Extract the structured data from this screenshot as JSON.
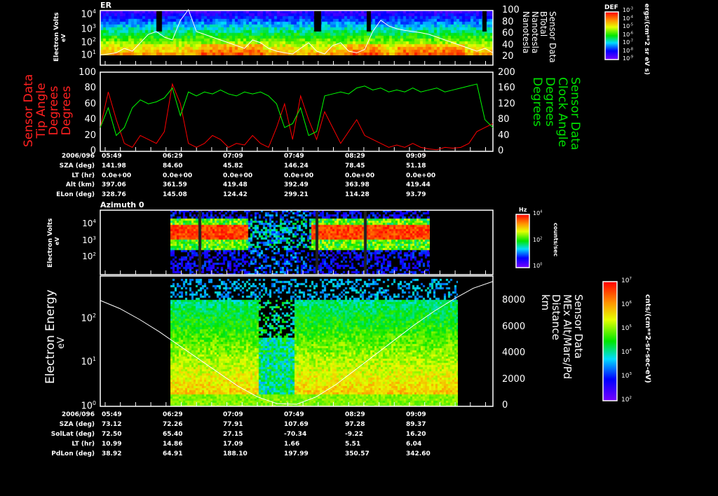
{
  "chart_data": [
    {
      "type": "heatmap",
      "title": "ER",
      "ylabel": "Electron Volts",
      "yunit": "eV",
      "yscale": "log",
      "yticks": [
        "10^1",
        "10^2",
        "10^3",
        "10^4"
      ],
      "right_axis": {
        "label": [
          "Sensor Data",
          "BTotal",
          "Nanotesla",
          "Nanotesla"
        ],
        "ticks": [
          20,
          40,
          60,
          80,
          100
        ]
      },
      "colorbar": {
        "title": "DEF",
        "unit": "ergs/(cm**2 sr eV s)",
        "ticks": [
          "10^-3",
          "10^-4",
          "10^-5",
          "10^-6",
          "10^-7",
          "10^-8",
          "10^-9"
        ]
      },
      "btotal_nT": [
        18,
        20,
        22,
        30,
        25,
        40,
        55,
        60,
        50,
        45,
        80,
        99,
        60,
        55,
        50,
        45,
        40,
        35,
        30,
        45,
        40,
        30,
        25,
        22,
        20,
        30,
        40,
        25,
        20,
        35,
        40,
        25,
        22,
        28,
        60,
        80,
        70,
        65,
        62,
        60,
        58,
        55,
        50,
        45,
        40,
        35,
        30,
        25,
        30,
        22
      ]
    },
    {
      "type": "line",
      "left_label": [
        "Sensor Data",
        "Tip Angle",
        "Degrees",
        "Degrees"
      ],
      "right_label": [
        "Sensor Data",
        "Clock Angle",
        "Degrees",
        "Degrees"
      ],
      "ylim": [
        0,
        100
      ],
      "y2lim": [
        0,
        200
      ],
      "yticks": [
        0,
        20,
        40,
        60,
        80,
        100
      ],
      "y2ticks": [
        0,
        40,
        80,
        120,
        160,
        200
      ],
      "series": [
        {
          "name": "Tip Angle",
          "color": "#ff0000",
          "values": [
            30,
            75,
            40,
            10,
            5,
            20,
            15,
            10,
            25,
            85,
            60,
            10,
            5,
            10,
            20,
            15,
            5,
            10,
            8,
            20,
            10,
            5,
            30,
            60,
            15,
            70,
            40,
            15,
            50,
            30,
            10,
            25,
            40,
            20,
            15,
            10,
            5,
            8,
            5,
            10,
            5,
            3,
            2,
            5,
            4,
            5,
            10,
            25,
            30,
            35
          ]
        },
        {
          "name": "Clock Angle",
          "color": "#00ff00",
          "values": [
            60,
            110,
            40,
            60,
            110,
            130,
            120,
            125,
            135,
            160,
            90,
            150,
            140,
            150,
            145,
            155,
            145,
            140,
            150,
            145,
            150,
            140,
            120,
            60,
            70,
            110,
            40,
            50,
            140,
            145,
            150,
            145,
            160,
            165,
            155,
            160,
            150,
            155,
            150,
            160,
            150,
            155,
            160,
            150,
            155,
            160,
            165,
            170,
            80,
            60
          ]
        }
      ]
    },
    {
      "type": "heatmap",
      "title": "Azimuth 0",
      "ylabel": "Electron Volts",
      "yunit": "eV",
      "yticks": [
        "10^2",
        "10^3",
        "10^4"
      ],
      "colorbar": {
        "title": "Hz",
        "unit": "counts/sec",
        "ticks": [
          "10^4",
          "10^2",
          "10^0"
        ]
      }
    },
    {
      "type": "heatmap",
      "ylabel": "Electron Energy",
      "yunit": "eV",
      "yticks": [
        "10^0",
        "10^1",
        "10^2"
      ],
      "right_axis": {
        "label": [
          "Sensor Data",
          "MEx Alt/Mars/Pd",
          "Distance",
          "km"
        ],
        "ticks": [
          0,
          2000,
          4000,
          6000,
          8000
        ]
      },
      "colorbar": {
        "unit": "cnts/(cm**2-sr-sec-eV)",
        "ticks": [
          "10^7",
          "10^6",
          "10^5",
          "10^4",
          "10^3",
          "10^2"
        ]
      },
      "altitude_km": [
        7800,
        7200,
        6400,
        5500,
        4500,
        3500,
        2500,
        1500,
        700,
        200,
        150,
        700,
        1600,
        2700,
        3800,
        4900,
        6000,
        7000,
        7900,
        8700,
        9200
      ]
    }
  ],
  "top_table": {
    "rows": [
      {
        "label": "2006/096",
        "values": [
          "05:49",
          "06:29",
          "07:09",
          "07:49",
          "08:29",
          "09:09"
        ]
      },
      {
        "label": "SZA (deg)",
        "values": [
          "141.98",
          "84.60",
          "45.82",
          "146.24",
          "78.45",
          "51.18"
        ]
      },
      {
        "label": "LT (hr)",
        "values": [
          "0.0e+00",
          "0.0e+00",
          "0.0e+00",
          "0.0e+00",
          "0.0e+00",
          "0.0e+00"
        ]
      },
      {
        "label": "Alt (km)",
        "values": [
          "397.06",
          "361.59",
          "419.48",
          "392.49",
          "363.98",
          "419.44"
        ]
      },
      {
        "label": "ELon (deg)",
        "values": [
          "328.76",
          "145.08",
          "124.42",
          "299.21",
          "114.28",
          "93.79"
        ]
      }
    ]
  },
  "bottom_table": {
    "rows": [
      {
        "label": "2006/096",
        "values": [
          "05:49",
          "06:29",
          "07:09",
          "07:49",
          "08:29",
          "09:09"
        ]
      },
      {
        "label": "SZA (deg)",
        "values": [
          "73.12",
          "72.26",
          "77.91",
          "107.69",
          "97.28",
          "89.37"
        ]
      },
      {
        "label": "SolLat (deg)",
        "values": [
          "72.50",
          "65.40",
          "27.15",
          "-70.34",
          "-9.22",
          "16.20"
        ]
      },
      {
        "label": "LT (hr)",
        "values": [
          "10.99",
          "14.86",
          "17.09",
          "1.66",
          "5.51",
          "6.04"
        ]
      },
      {
        "label": "PdLon (deg)",
        "values": [
          "38.92",
          "64.91",
          "188.10",
          "197.99",
          "350.57",
          "342.60"
        ]
      }
    ]
  }
}
